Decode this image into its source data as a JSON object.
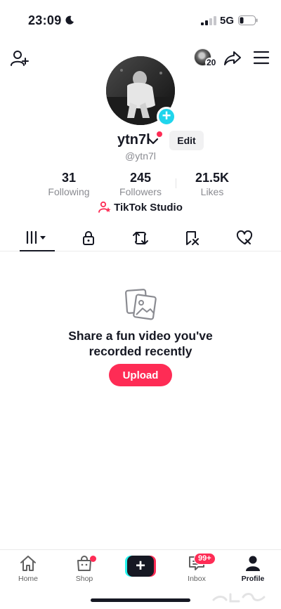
{
  "status_bar": {
    "time": "23:09",
    "network": "5G",
    "icons": [
      "moon-icon",
      "signal-icon",
      "battery-icon"
    ]
  },
  "top_bar": {
    "visitor_count": "20",
    "icons": [
      "add-friend-icon",
      "share-icon",
      "menu-icon"
    ]
  },
  "profile": {
    "display_name": "ytn7l",
    "username": "@ytn7l",
    "edit_label": "Edit",
    "stats": [
      {
        "value": "31",
        "label": "Following"
      },
      {
        "value": "245",
        "label": "Followers"
      },
      {
        "value": "21.5K",
        "label": "Likes"
      }
    ],
    "studio_label": "TikTok Studio"
  },
  "tabs": [
    {
      "name": "videos",
      "icon": "grid-icon",
      "selected": true
    },
    {
      "name": "private",
      "icon": "lock-icon"
    },
    {
      "name": "reposts",
      "icon": "repost-icon"
    },
    {
      "name": "favorites",
      "icon": "bookmark-icon"
    },
    {
      "name": "liked",
      "icon": "heart-icon"
    }
  ],
  "empty_state": {
    "title_line1": "Share a fun video you've",
    "title_line2": "recorded recently",
    "button_label": "Upload"
  },
  "bottom_nav": {
    "home": "Home",
    "shop": "Shop",
    "inbox": "Inbox",
    "inbox_badge": "99+",
    "profile": "Profile"
  },
  "colors": {
    "accent": "#fe2c55",
    "cyan": "#25f4ee",
    "text": "#161823",
    "muted": "#8a8b91"
  }
}
